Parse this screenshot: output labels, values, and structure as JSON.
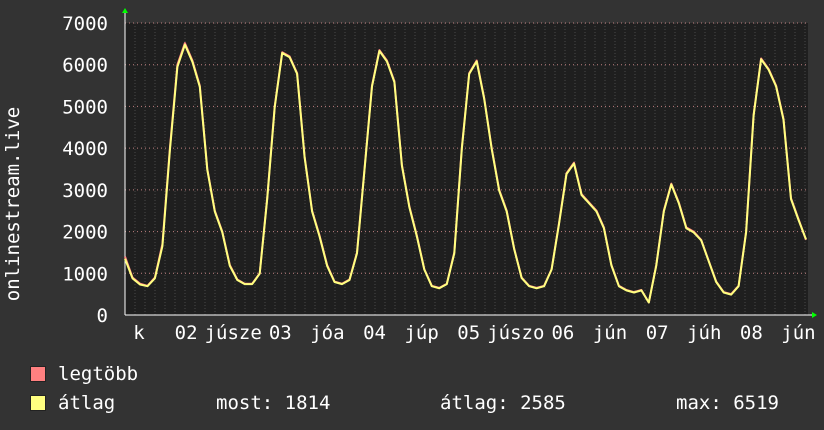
{
  "chart_data": {
    "type": "line",
    "ylabel": "onlinestream.live",
    "ylim": [
      0,
      7000
    ],
    "yticks": [
      0,
      1000,
      2000,
      3000,
      4000,
      5000,
      6000,
      7000
    ],
    "grid": true,
    "xtick_labels": [
      "k",
      "02",
      "júsze",
      "03",
      "jóa",
      "04",
      "júp",
      "05",
      "júszo",
      "06",
      "jún",
      "07",
      "júh",
      "08",
      "jún"
    ],
    "series": [
      {
        "name": "legtöbb",
        "color": "#ff8080",
        "values": [
          1400,
          900,
          750,
          700,
          900,
          1700,
          4000,
          6000,
          6519,
          6100,
          5500,
          3500,
          2500,
          2000,
          1200,
          850,
          750,
          750,
          1000,
          2800,
          5000,
          6300,
          6200,
          5800,
          3800,
          2500,
          1900,
          1200,
          800,
          750,
          850,
          1500,
          3500,
          5500,
          6350,
          6100,
          5600,
          3600,
          2600,
          1900,
          1100,
          700,
          650,
          750,
          1500,
          4000,
          5800,
          6100,
          5200,
          4000,
          3000,
          2500,
          1600,
          900,
          700,
          650,
          700,
          1100,
          2200,
          3400,
          3650,
          2900,
          2700,
          2500,
          2100,
          1200,
          700,
          600,
          550,
          600,
          300,
          1200,
          2500,
          3150,
          2700,
          2100,
          2000,
          1800,
          1300,
          800,
          550,
          500,
          700,
          2000,
          4800,
          6150,
          5900,
          5500,
          4700,
          2800,
          2300,
          1800
        ]
      },
      {
        "name": "átlag",
        "color": "#ffff80",
        "values": [
          1350,
          880,
          730,
          690,
          880,
          1650,
          3950,
          5950,
          6480,
          6070,
          5470,
          3480,
          2480,
          1980,
          1180,
          840,
          740,
          740,
          990,
          2780,
          4980,
          6280,
          6180,
          5780,
          3780,
          2480,
          1880,
          1180,
          790,
          740,
          840,
          1480,
          3480,
          5480,
          6330,
          6080,
          5580,
          3580,
          2580,
          1880,
          1090,
          690,
          640,
          740,
          1480,
          3980,
          5780,
          6080,
          5180,
          3980,
          2980,
          2480,
          1590,
          890,
          690,
          640,
          690,
          1090,
          2180,
          3380,
          3630,
          2880,
          2680,
          2480,
          2080,
          1190,
          690,
          590,
          540,
          590,
          300,
          1190,
          2480,
          3130,
          2680,
          2080,
          1980,
          1790,
          1290,
          790,
          540,
          490,
          690,
          1980,
          4780,
          6130,
          5880,
          5480,
          4680,
          2780,
          2280,
          1814
        ]
      }
    ]
  },
  "legend": [
    {
      "label": "legtöbb",
      "color": "#ff8080"
    },
    {
      "label": "átlag",
      "color": "#ffff80"
    }
  ],
  "stats": {
    "now": "most: 1814",
    "avg": "átlag: 2585",
    "max": "max: 6519"
  }
}
